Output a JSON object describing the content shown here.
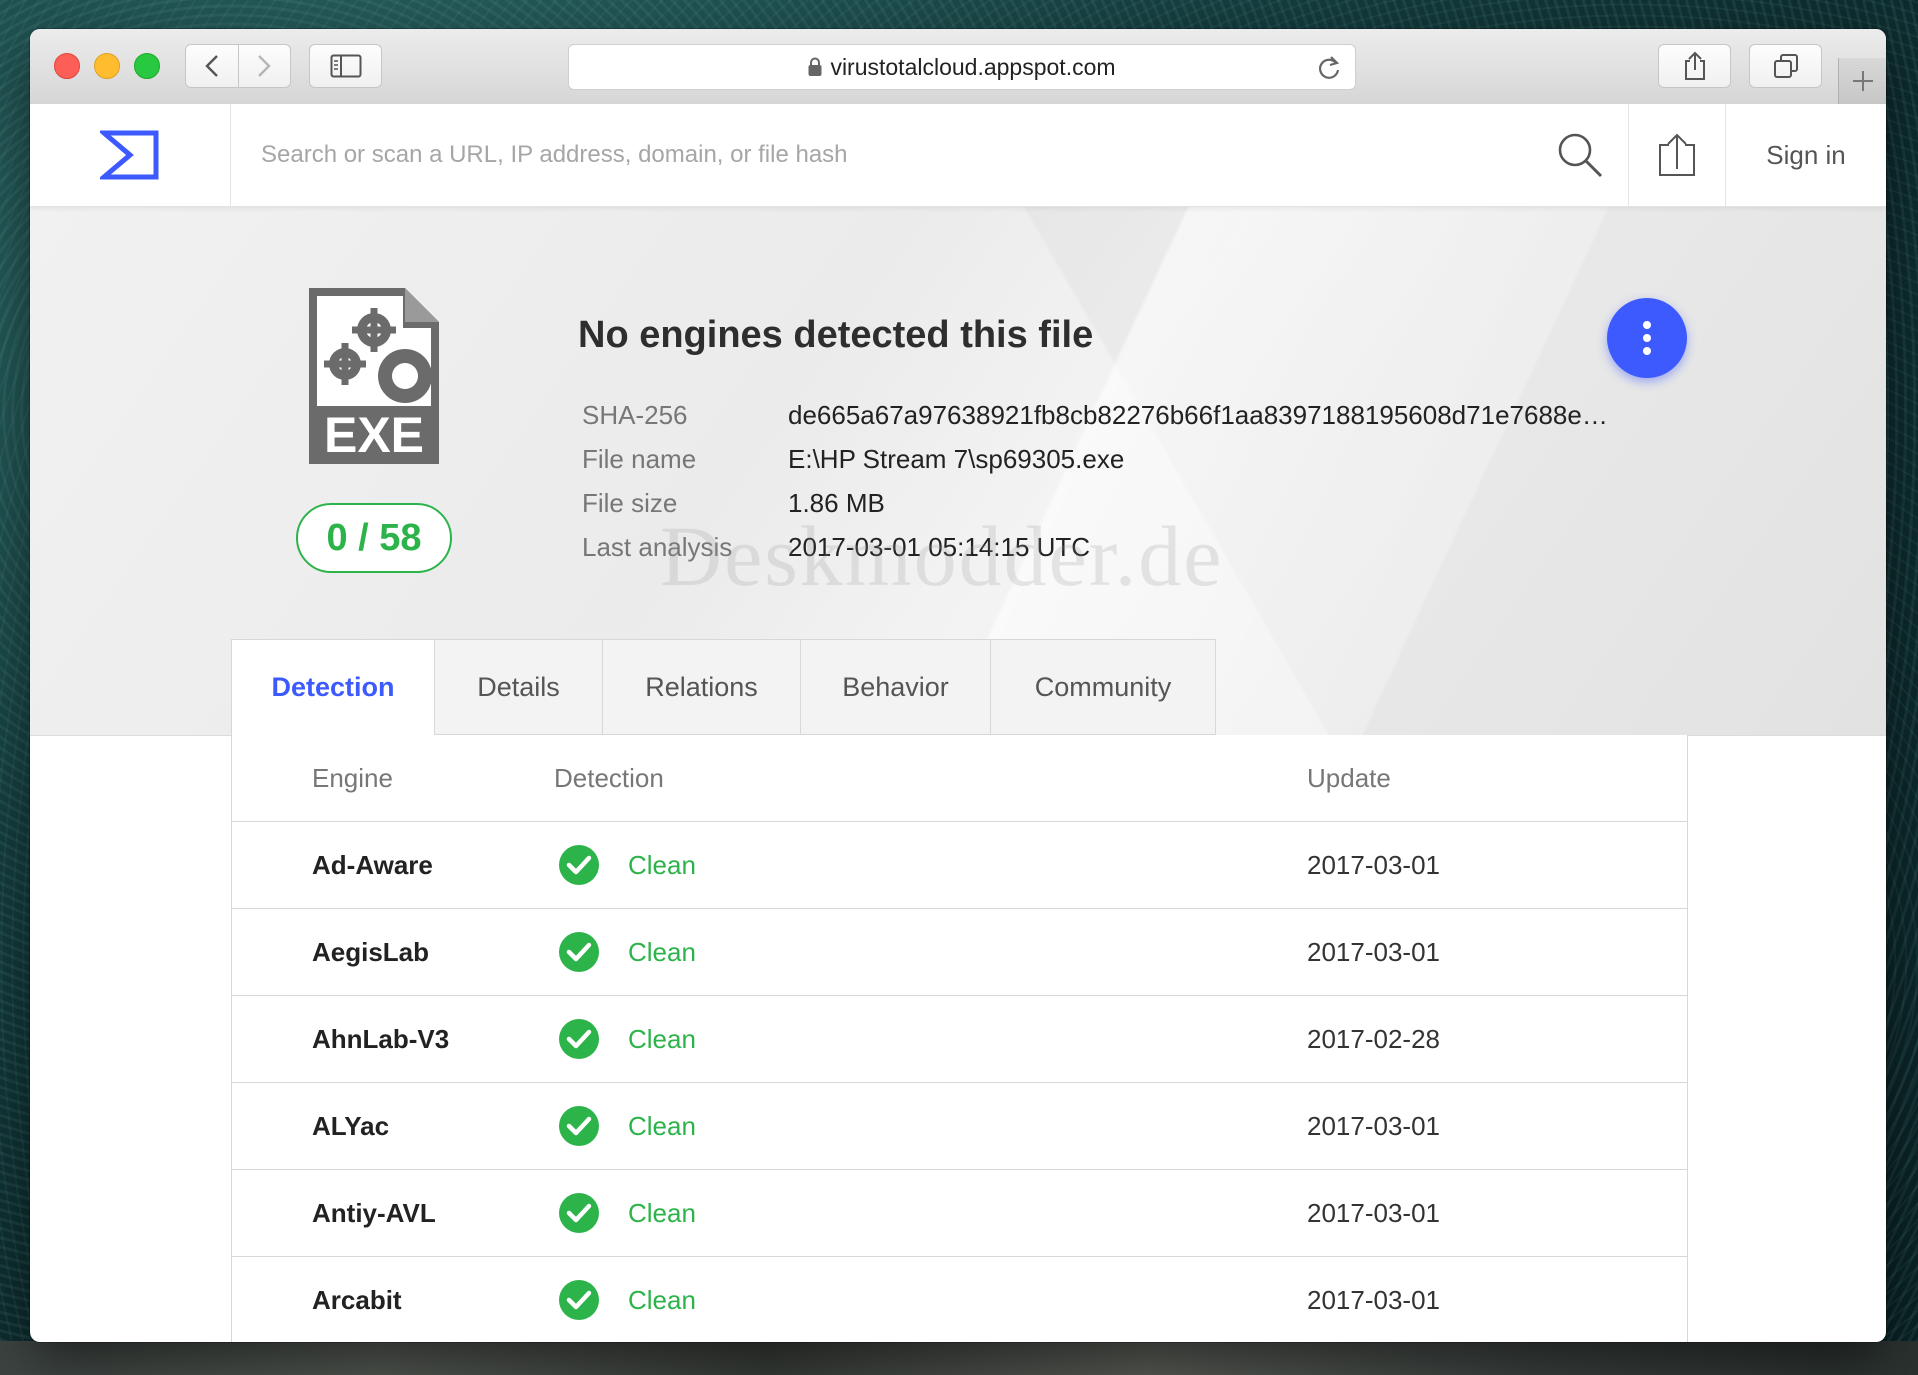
{
  "browser": {
    "url": "virustotalcloud.appspot.com"
  },
  "header": {
    "search_placeholder": "Search or scan a URL, IP address, domain, or file hash",
    "sign_in": "Sign in"
  },
  "summary": {
    "file_type": "EXE",
    "score": "0 / 58",
    "headline": "No engines detected this file",
    "fields": [
      {
        "key": "SHA-256",
        "value": "de665a67a97638921fb8cb82276b66f1aa8397188195608d71e7688e…"
      },
      {
        "key": "File name",
        "value": "E:\\HP Stream 7\\sp69305.exe"
      },
      {
        "key": "File size",
        "value": "1.86 MB"
      },
      {
        "key": "Last analysis",
        "value": "2017-03-01 05:14:15 UTC"
      }
    ],
    "watermark": "Deskmodder.de"
  },
  "tabs": [
    {
      "label": "Detection",
      "active": true
    },
    {
      "label": "Details",
      "active": false
    },
    {
      "label": "Relations",
      "active": false
    },
    {
      "label": "Behavior",
      "active": false
    },
    {
      "label": "Community",
      "active": false
    }
  ],
  "table": {
    "headers": {
      "engine": "Engine",
      "detection": "Detection",
      "update": "Update"
    },
    "rows": [
      {
        "engine": "Ad-Aware",
        "result": "Clean",
        "update": "2017-03-01"
      },
      {
        "engine": "AegisLab",
        "result": "Clean",
        "update": "2017-03-01"
      },
      {
        "engine": "AhnLab-V3",
        "result": "Clean",
        "update": "2017-02-28"
      },
      {
        "engine": "ALYac",
        "result": "Clean",
        "update": "2017-03-01"
      },
      {
        "engine": "Antiy-AVL",
        "result": "Clean",
        "update": "2017-03-01"
      },
      {
        "engine": "Arcabit",
        "result": "Clean",
        "update": "2017-03-01"
      }
    ]
  },
  "colors": {
    "accent": "#3d5afe",
    "clean": "#2cb34a"
  }
}
